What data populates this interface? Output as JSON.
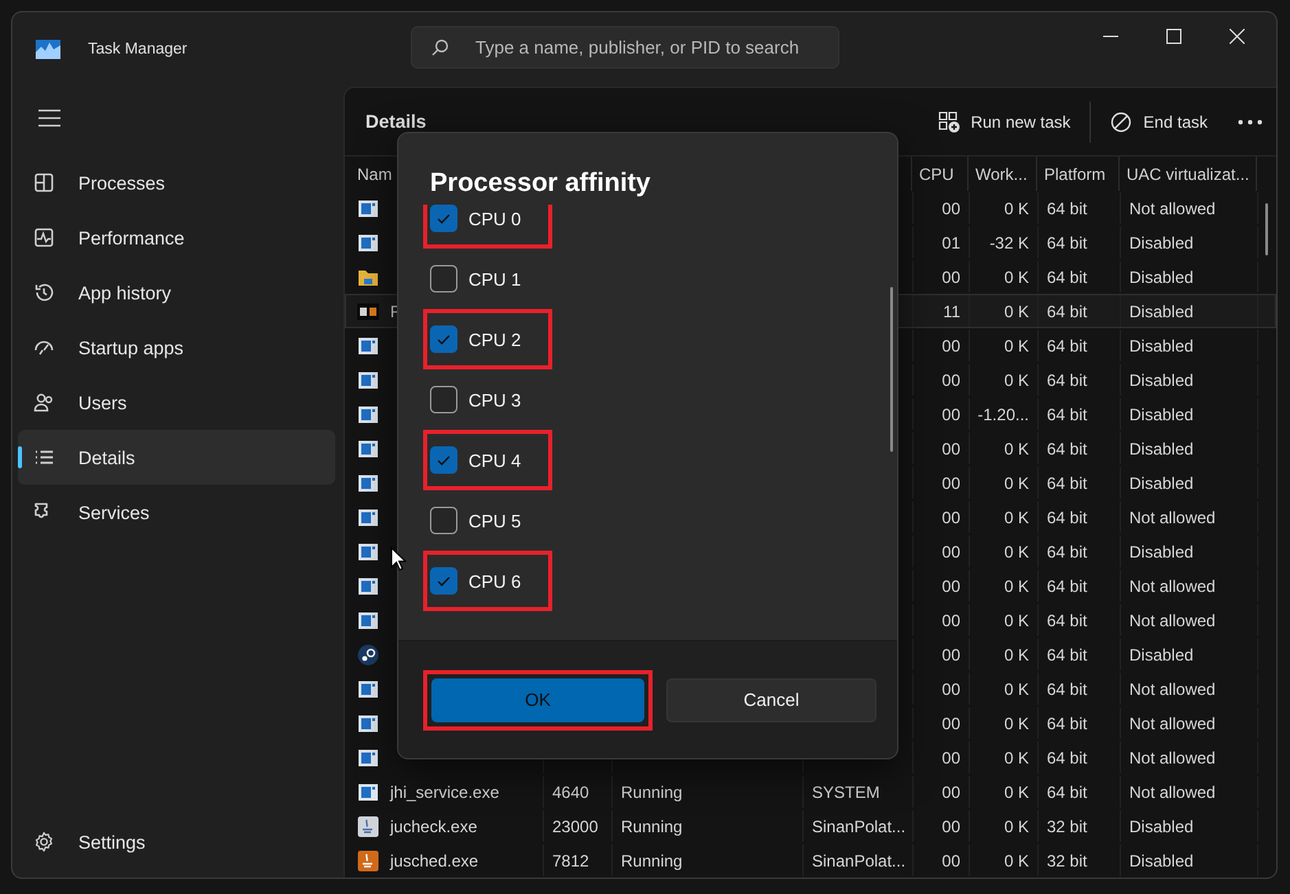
{
  "window": {
    "title": "Task Manager"
  },
  "search": {
    "placeholder": "Type a name, publisher, or PID to search"
  },
  "sidebar": {
    "items": [
      {
        "label": "Processes",
        "selected": false
      },
      {
        "label": "Performance",
        "selected": false
      },
      {
        "label": "App history",
        "selected": false
      },
      {
        "label": "Startup apps",
        "selected": false
      },
      {
        "label": "Users",
        "selected": false
      },
      {
        "label": "Details",
        "selected": true
      },
      {
        "label": "Services",
        "selected": false
      }
    ],
    "footer": {
      "label": "Settings"
    }
  },
  "details": {
    "title": "Details",
    "actions": [
      "Run new task",
      "End task"
    ]
  },
  "table": {
    "columns": [
      "Nam",
      "CPU",
      "Work...",
      "Platform",
      "UAC virtualizat..."
    ],
    "rows": [
      {
        "kind": "service",
        "cpu": "00",
        "working_set": "0 K",
        "platform": "64 bit",
        "uac": "Not allowed",
        "selected": false
      },
      {
        "kind": "service",
        "cpu": "01",
        "working_set": "-32 K",
        "platform": "64 bit",
        "uac": "Disabled",
        "selected": false
      },
      {
        "kind": "folder",
        "cpu": "00",
        "working_set": "0 K",
        "platform": "64 bit",
        "uac": "Disabled",
        "selected": false
      },
      {
        "kind": "game",
        "name": "F",
        "cpu": "11",
        "working_set": "0 K",
        "platform": "64 bit",
        "uac": "Disabled",
        "selected": true
      },
      {
        "kind": "service",
        "cpu": "00",
        "working_set": "0 K",
        "platform": "64 bit",
        "uac": "Disabled",
        "selected": false
      },
      {
        "kind": "service",
        "cpu": "00",
        "working_set": "0 K",
        "platform": "64 bit",
        "uac": "Disabled",
        "selected": false
      },
      {
        "kind": "service",
        "cpu": "00",
        "working_set": "-1.20...",
        "platform": "64 bit",
        "uac": "Disabled",
        "selected": false
      },
      {
        "kind": "service",
        "cpu": "00",
        "working_set": "0 K",
        "platform": "64 bit",
        "uac": "Disabled",
        "selected": false
      },
      {
        "kind": "service",
        "cpu": "00",
        "working_set": "0 K",
        "platform": "64 bit",
        "uac": "Disabled",
        "selected": false
      },
      {
        "kind": "service",
        "cpu": "00",
        "working_set": "0 K",
        "platform": "64 bit",
        "uac": "Not allowed",
        "selected": false
      },
      {
        "kind": "service",
        "cpu": "00",
        "working_set": "0 K",
        "platform": "64 bit",
        "uac": "Disabled",
        "selected": false
      },
      {
        "kind": "service",
        "cpu": "00",
        "working_set": "0 K",
        "platform": "64 bit",
        "uac": "Not allowed",
        "selected": false
      },
      {
        "kind": "service",
        "cpu": "00",
        "working_set": "0 K",
        "platform": "64 bit",
        "uac": "Not allowed",
        "selected": false
      },
      {
        "kind": "steam",
        "cpu": "00",
        "working_set": "0 K",
        "platform": "64 bit",
        "uac": "Disabled",
        "selected": false
      },
      {
        "kind": "service",
        "cpu": "00",
        "working_set": "0 K",
        "platform": "64 bit",
        "uac": "Not allowed",
        "selected": false
      },
      {
        "kind": "service",
        "cpu": "00",
        "working_set": "0 K",
        "platform": "64 bit",
        "uac": "Not allowed",
        "selected": false
      },
      {
        "kind": "service",
        "cpu": "00",
        "working_set": "0 K",
        "platform": "64 bit",
        "uac": "Not allowed",
        "selected": false
      },
      {
        "kind": "service",
        "name": "jhi_service.exe",
        "pid": "4640",
        "status": "Running",
        "user": "SYSTEM",
        "cpu": "00",
        "working_set": "0 K",
        "platform": "64 bit",
        "uac": "Not allowed",
        "selected": false
      },
      {
        "kind": "checker",
        "name": "jucheck.exe",
        "pid": "23000",
        "status": "Running",
        "user": "SinanPolat...",
        "cpu": "00",
        "working_set": "0 K",
        "platform": "32 bit",
        "uac": "Disabled",
        "selected": false
      },
      {
        "kind": "scheduler",
        "name": "jusched.exe",
        "pid": "7812",
        "status": "Running",
        "user": "SinanPolat...",
        "cpu": "00",
        "working_set": "0 K",
        "platform": "32 bit",
        "uac": "Disabled",
        "selected": false
      }
    ]
  },
  "dialog": {
    "title": "Processor affinity",
    "options": [
      {
        "label": "CPU 0",
        "checked": true,
        "highlighted": true
      },
      {
        "label": "CPU 1",
        "checked": false,
        "highlighted": false
      },
      {
        "label": "CPU 2",
        "checked": true,
        "highlighted": true
      },
      {
        "label": "CPU 3",
        "checked": false,
        "highlighted": false
      },
      {
        "label": "CPU 4",
        "checked": true,
        "highlighted": true
      },
      {
        "label": "CPU 5",
        "checked": false,
        "highlighted": false
      },
      {
        "label": "CPU 6",
        "checked": true,
        "highlighted": true
      }
    ],
    "buttons": [
      {
        "label": "OK",
        "kind": "primary",
        "highlighted": true
      },
      {
        "label": "Cancel",
        "kind": "secondary",
        "highlighted": false
      }
    ]
  }
}
